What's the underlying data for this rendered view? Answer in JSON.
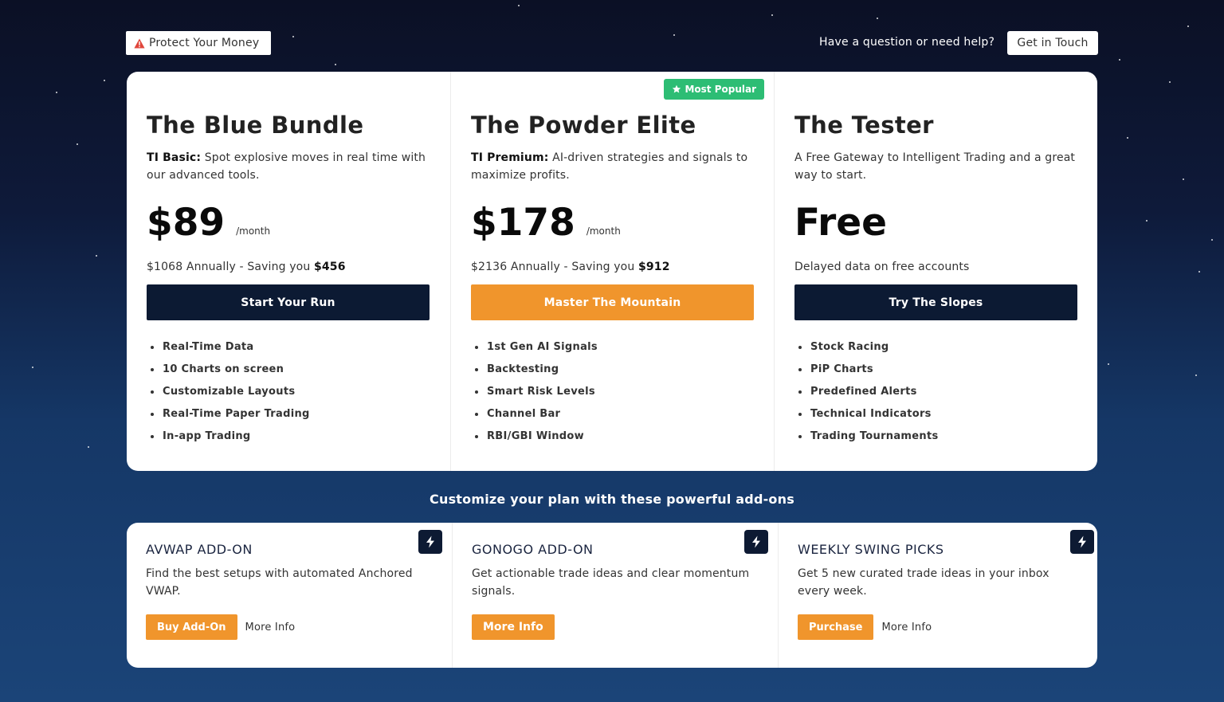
{
  "topbar": {
    "protect_label": "Protect Your Money",
    "help_text": "Have a question or need help?",
    "contact_label": "Get in Touch"
  },
  "plans": [
    {
      "name": "The Blue Bundle",
      "desc_prefix": "TI Basic:",
      "desc": "Spot explosive moves in real time with our advanced tools.",
      "price": "$89",
      "period": "/month",
      "annual_text": "$1068 Annually - Saving you",
      "saving": "$456",
      "cta": "Start Your Run",
      "features": [
        "Real-Time Data",
        "10 Charts on screen",
        "Customizable Layouts",
        "Real-Time Paper Trading",
        "In-app Trading"
      ]
    },
    {
      "name": "The Powder Elite",
      "badge": "Most Popular",
      "desc_prefix": "TI Premium:",
      "desc": "AI-driven strategies and signals to maximize profits.",
      "price": "$178",
      "period": "/month",
      "annual_text": "$2136 Annually - Saving you",
      "saving": "$912",
      "cta": "Master The Mountain",
      "features": [
        "1st Gen AI Signals",
        "Backtesting",
        "Smart Risk Levels",
        "Channel Bar",
        "RBI/GBI Window"
      ]
    },
    {
      "name": "The Tester",
      "desc": "A Free Gateway to Intelligent Trading and a great way to start.",
      "price": "Free",
      "annual_text": "Delayed data on free accounts",
      "cta": "Try The Slopes",
      "features": [
        "Stock Racing",
        "PiP Charts",
        "Predefined Alerts",
        "Technical Indicators",
        "Trading Tournaments"
      ]
    }
  ],
  "addons_title": "Customize your plan with these powerful add-ons",
  "addons": [
    {
      "name": "AVWAP ADD-ON",
      "desc": "Find the best setups with automated Anchored VWAP.",
      "primary": "Buy Add-On",
      "secondary": "More Info"
    },
    {
      "name": "GONOGO ADD-ON",
      "desc": "Get actionable trade ideas and clear momentum signals.",
      "primary": "More Info"
    },
    {
      "name": "WEEKLY SWING PICKS",
      "desc": "Get 5 new curated trade ideas in your inbox every week.",
      "primary": "Purchase",
      "secondary": "More Info"
    }
  ],
  "colors": {
    "navy": "#0c1a33",
    "orange": "#f0952c",
    "green_badge": "#2dbd74",
    "warning_red": "#e0463c"
  },
  "icons": {
    "protect": "warning-triangle-icon",
    "badge": "star-icon",
    "addon": "lightning-bolt-icon"
  }
}
